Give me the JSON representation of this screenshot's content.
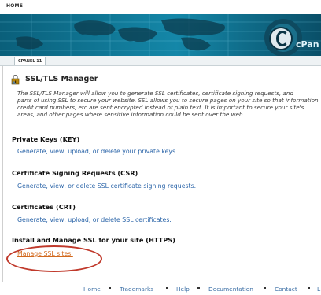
{
  "top_nav": {
    "home_label": "HOME"
  },
  "banner": {
    "brand_text": "cPan"
  },
  "tabstrip": {
    "tab_label": "CPANEL 11"
  },
  "page": {
    "title": "SSL/TLS Manager",
    "description_lines": [
      "The SSL/TLS Manager will allow you to generate SSL certificates, certificate signing requests, and",
      "parts of using SSL to secure your website. SSL allows you to secure pages on your site so that information",
      "credit card numbers, etc are sent encrypted instead of plain text. It is important to secure your site's",
      "areas, and other pages where sensitive information could be sent over the web."
    ]
  },
  "sections": [
    {
      "heading": "Private Keys (KEY)",
      "link": "Generate, view, upload, or delete your private keys."
    },
    {
      "heading": "Certificate Signing Requests (CSR)",
      "link": "Generate, view, or delete SSL certificate signing requests."
    },
    {
      "heading": "Certificates (CRT)",
      "link": "Generate, view, upload, or delete SSL certificates."
    },
    {
      "heading": "Install and Manage SSL for your site (HTTPS)",
      "link": "Manage SSL sites."
    }
  ],
  "footer": {
    "items": [
      "Home",
      "Trademarks",
      "Help",
      "Documentation",
      "Contact",
      "L"
    ]
  },
  "colors": {
    "banner": "#0d6f8c",
    "link": "#2a64a8",
    "highlight_link": "#d2691e",
    "annotation_oval": "#c0392b"
  }
}
